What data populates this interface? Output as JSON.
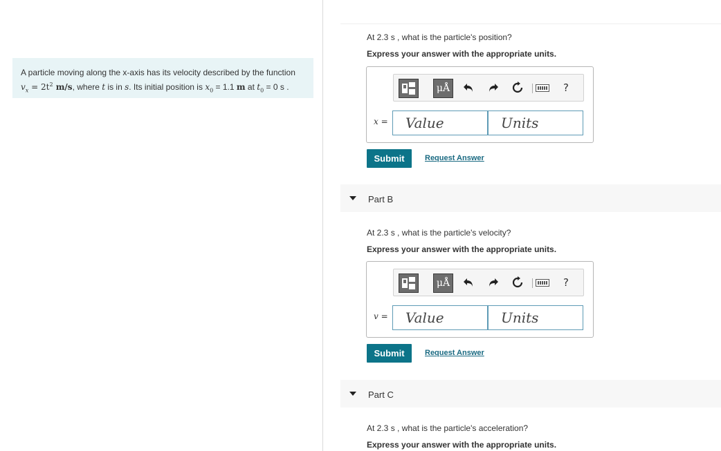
{
  "problem": {
    "text_1": "A particle moving along the x-axis has its velocity described by the function",
    "vx_sym": "v",
    "vx_sub": "x",
    "eq_rhs": "= 2t",
    "eq_exp": "2",
    "eq_units": " m/s",
    "text_2": ", where ",
    "t_var": "t",
    "text_3": " is in ",
    "s_unit": "s",
    "text_4": ". Its initial position is ",
    "x_sym": "x",
    "x_sub": "0",
    "text_5": " = 1.1 ",
    "m_unit": "m",
    "text_6": " at ",
    "t0_sym": "t",
    "t0_sub": "0",
    "text_7": " = 0 s ."
  },
  "part_a": {
    "question": "At 2.3 s , what is the particle's position?",
    "instruction": "Express your answer with the appropriate units.",
    "variable_label": "x =",
    "value_placeholder": "Value",
    "units_placeholder": "Units",
    "submit_label": "Submit",
    "request_label": "Request Answer"
  },
  "part_b": {
    "title": "Part B",
    "question": "At 2.3 s , what is the particle's velocity?",
    "instruction": "Express your answer with the appropriate units.",
    "variable_label": "v =",
    "value_placeholder": "Value",
    "units_placeholder": "Units",
    "submit_label": "Submit",
    "request_label": "Request Answer"
  },
  "part_c": {
    "title": "Part C",
    "question": "At 2.3 s , what is the particle's acceleration?",
    "instruction": "Express your answer with the appropriate units."
  },
  "toolbar": {
    "units_button_label": "μÅ",
    "help_label": "?",
    "icons": [
      "templates-icon",
      "units-icon",
      "undo-icon",
      "redo-icon",
      "reset-icon",
      "keyboard-icon",
      "help-icon"
    ]
  },
  "colors": {
    "submit_bg": "#0c7489",
    "link": "#1a6a82",
    "problem_bg": "#e8f4f6",
    "input_border": "#5d9ab5"
  }
}
